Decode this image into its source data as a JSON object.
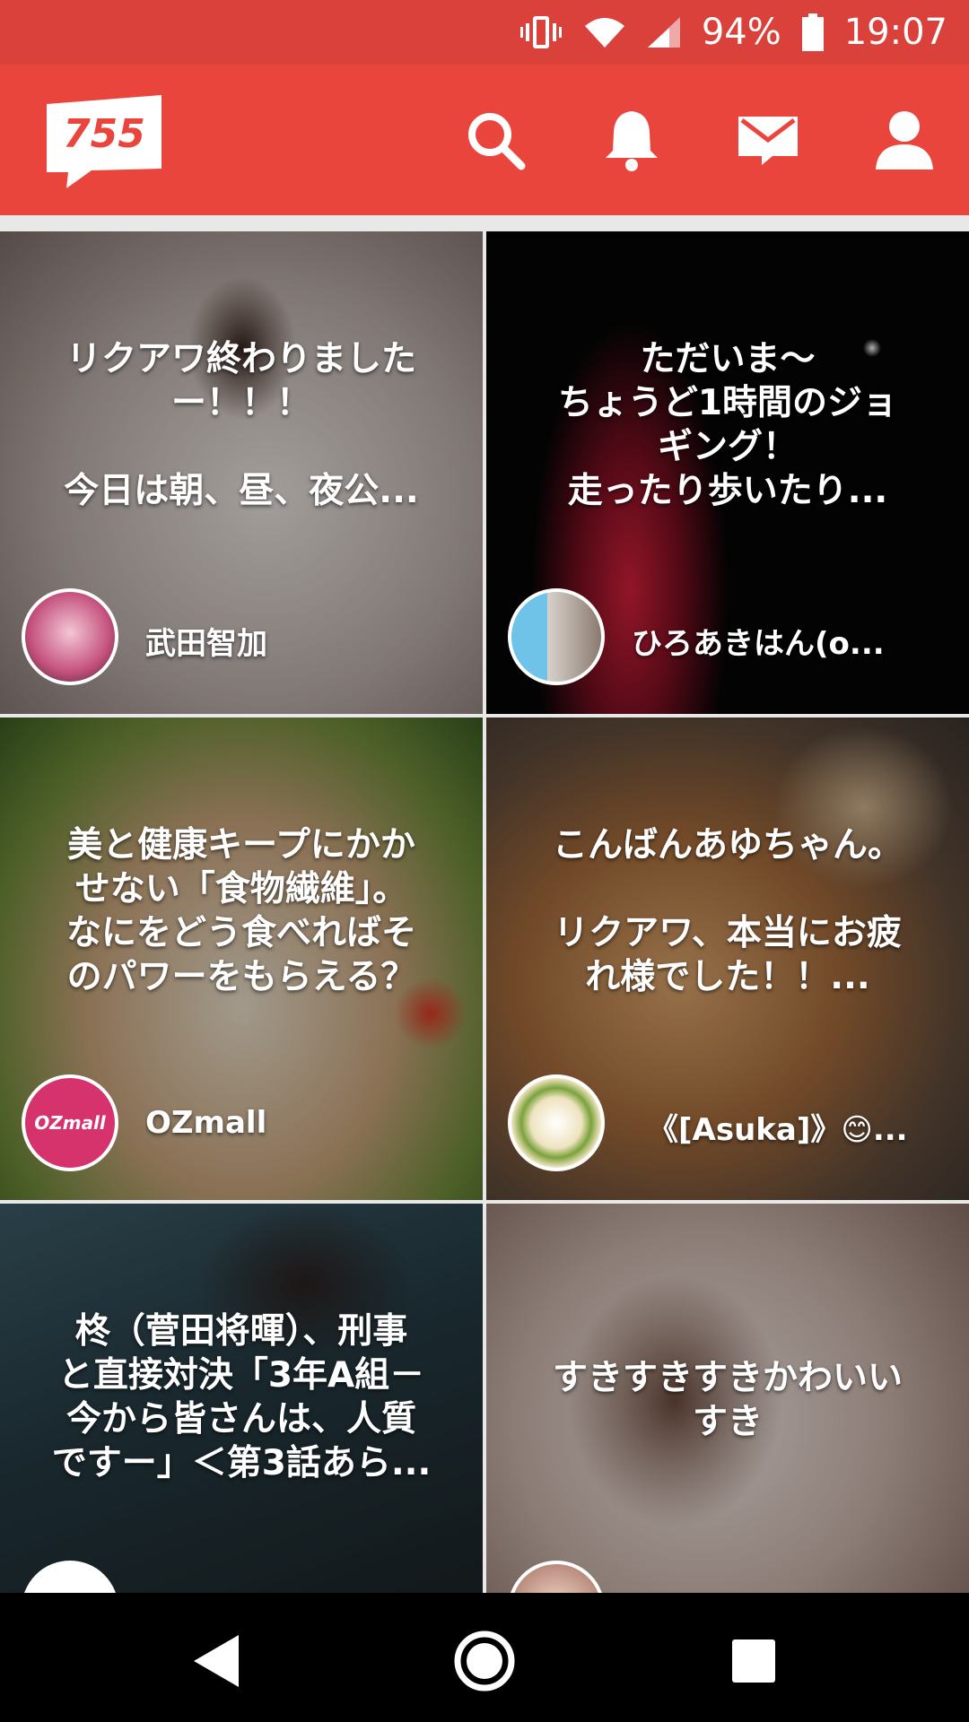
{
  "status_bar": {
    "battery": "94%",
    "time": "19:07",
    "icons": [
      "vibrate-icon",
      "wifi-icon",
      "signal-icon",
      "battery-icon"
    ]
  },
  "app_bar": {
    "logo_text": "755",
    "actions": [
      "search-icon",
      "bell-icon",
      "mail-icon",
      "profile-icon"
    ],
    "color": "#e9453d"
  },
  "feed": {
    "cards": [
      {
        "caption": "リクアワ終わりました\nー！！！\n\n今日は朝、昼、夜公...",
        "author": "武田智加"
      },
      {
        "caption": "ただいま〜\nちょうど1時間のジョ\nギング！\n走ったり歩いたり...",
        "author": "ひろあきはん(o..."
      },
      {
        "caption": "美と健康キープにかか\nせない「食物繊維」。\nなにをどう食べればそ\nのパワーをもらえる？",
        "author": "OZmall",
        "avatar_text": "OZmall"
      },
      {
        "caption": "こんばんあゆちゃん。\n\nリクアワ、本当にお疲\nれ様でした！！...",
        "author": "《[Asuka]》😊..."
      },
      {
        "caption": "柊（菅田将暉）、刑事\nと直接対決「3年A組－\n今から皆さんは、人質\nですー」＜第3話あら...",
        "author": ""
      },
      {
        "caption": "すきすきすきかわいい\nすき",
        "author": ""
      }
    ]
  },
  "nav_bar": {
    "buttons": [
      "back-icon",
      "home-icon",
      "recents-icon"
    ]
  }
}
